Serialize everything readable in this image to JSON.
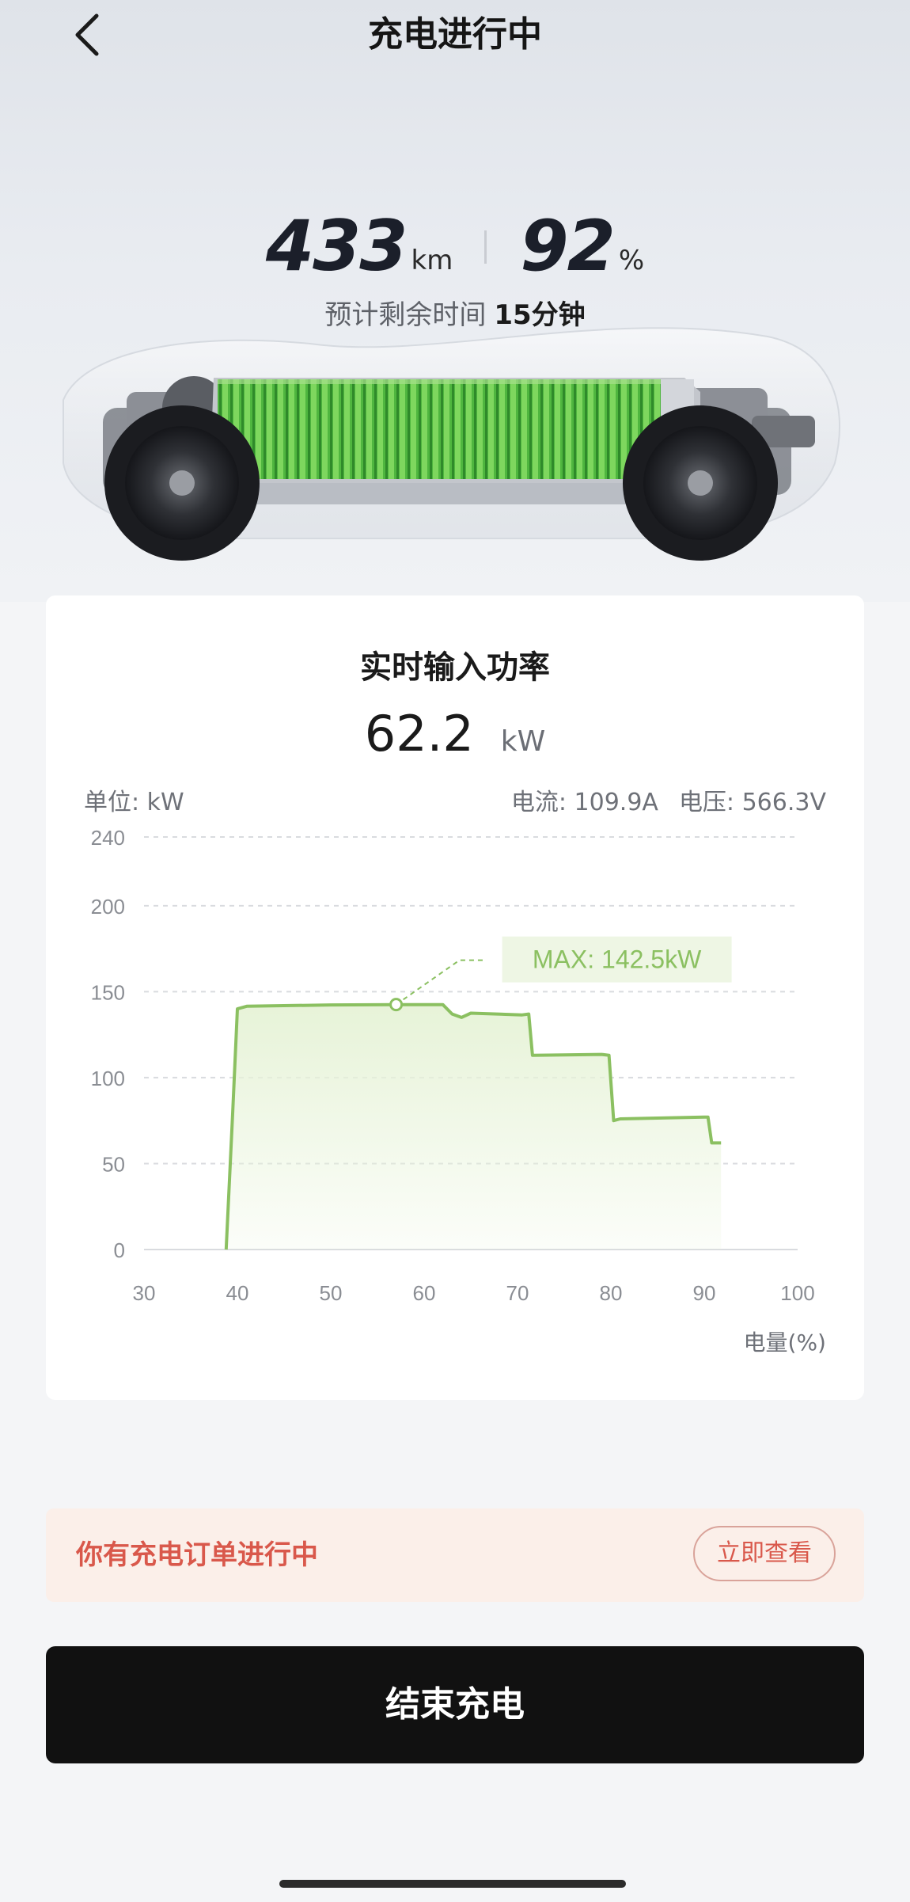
{
  "header": {
    "title": "充电进行中",
    "back_icon": "chevron-left-icon"
  },
  "status": {
    "range_value": "433",
    "range_unit": "km",
    "soc_value": "92",
    "soc_unit": "%",
    "eta_label": "预计剩余时间",
    "eta_value": "15分钟"
  },
  "power_card": {
    "title": "实时输入功率",
    "power_value": "62.2",
    "power_unit": "kW",
    "unit_label": "单位: kW",
    "current_label": "电流: 109.9A",
    "voltage_label": "电压: 566.3V"
  },
  "chart_data": {
    "type": "area",
    "title": "",
    "xlabel": "电量(%)",
    "ylabel": "单位: kW",
    "xlim": [
      30,
      100
    ],
    "ylim": [
      0,
      240
    ],
    "x_ticks": [
      30,
      40,
      50,
      60,
      70,
      80,
      90,
      100
    ],
    "y_ticks": [
      0,
      50,
      100,
      150,
      200,
      240
    ],
    "grid": true,
    "series": [
      {
        "x": [
          38.8,
          39.5,
          40.0,
          41.0,
          50.0,
          57.0,
          62.0,
          63.0,
          64.0,
          65.0,
          70.5,
          71.2,
          71.6,
          79.0,
          79.8,
          80.3,
          81.0,
          90.0,
          90.4,
          90.8,
          91.8
        ],
        "y": [
          0,
          80,
          140,
          141.5,
          142.3,
          142.5,
          142.5,
          137,
          135,
          137.5,
          136.5,
          137,
          113,
          113.5,
          113,
          75,
          76,
          77,
          77,
          62,
          62
        ]
      }
    ],
    "annotation": {
      "label": "MAX: 142.5kW",
      "x": 57,
      "y": 142.5
    },
    "colors": {
      "line": "#8bc061",
      "fill": "#e7f3d8",
      "grid": "#d9dbdf",
      "annotation_bg": "#eef6e4"
    }
  },
  "notice": {
    "text": "你有充电订单进行中",
    "button": "立即查看"
  },
  "end_button": "结束充电"
}
